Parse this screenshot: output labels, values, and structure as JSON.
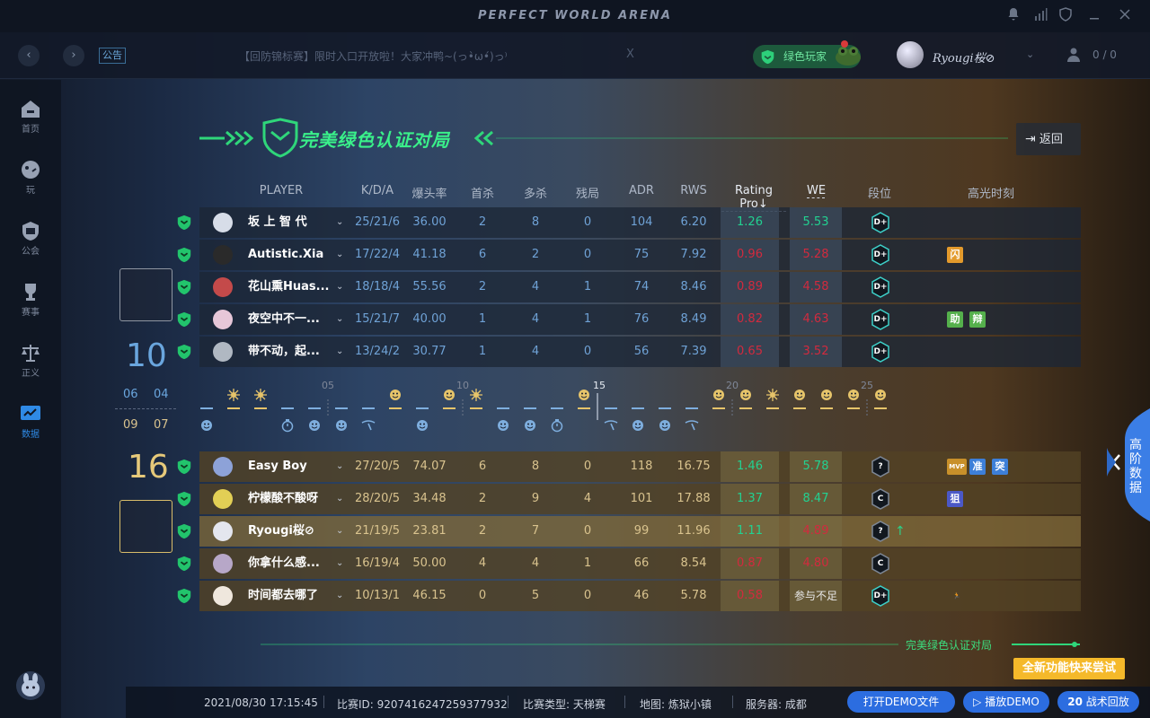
{
  "app": {
    "title": "PERFECT WORLD ARENA"
  },
  "topbar": {
    "notice_tag": "公告",
    "notice_text": "【回防锦标赛】限时入口开放啦！大家冲鸭~(っ•̀ω•́)っ⁾",
    "close": "X",
    "badge_label": "绿色玩家",
    "username": "Ryougi桜⊘",
    "friends_count": "0 / 0"
  },
  "sidebar": {
    "items": [
      {
        "label": "首页",
        "icon": "home-icon"
      },
      {
        "label": "玩",
        "icon": "gamepad-icon"
      },
      {
        "label": "公会",
        "icon": "guild-icon"
      },
      {
        "label": "赛事",
        "icon": "trophy-icon"
      },
      {
        "label": "正义",
        "icon": "scales-icon"
      },
      {
        "label": "数据",
        "icon": "chart-icon"
      }
    ]
  },
  "header": {
    "title": "完美绿色认证对局",
    "back_label": "返回"
  },
  "columns": [
    "PLAYER",
    "K/D/A",
    "爆头率",
    "首杀",
    "多杀",
    "残局",
    "ADR",
    "RWS",
    "Rating Pro",
    "WE",
    "段位",
    "高光时刻"
  ],
  "team_a": {
    "score": "10",
    "half1": "06",
    "half2": "04",
    "players": [
      {
        "name": "坂 上 智 代",
        "kda": "25/21/6",
        "hs": "36.00",
        "fk": "2",
        "mk": "8",
        "clutch": "0",
        "adr": "104",
        "rws": "6.20",
        "rating": "1.26",
        "we": "5.53",
        "rating_good": true,
        "we_good": true,
        "rank": "D+",
        "highlights": []
      },
      {
        "name": "Autistic.Xia",
        "kda": "17/22/4",
        "hs": "41.18",
        "fk": "6",
        "mk": "2",
        "clutch": "0",
        "adr": "75",
        "rws": "7.92",
        "rating": "0.96",
        "we": "5.28",
        "rating_good": false,
        "we_good": false,
        "rank": "D+",
        "highlights": [
          {
            "text": "闪",
            "color": "#e39a2c"
          }
        ]
      },
      {
        "name": "花山熏Huas...",
        "kda": "18/18/4",
        "hs": "55.56",
        "fk": "2",
        "mk": "4",
        "clutch": "1",
        "adr": "74",
        "rws": "8.46",
        "rating": "0.89",
        "we": "4.58",
        "rating_good": false,
        "we_good": false,
        "rank": "D+",
        "highlights": []
      },
      {
        "name": "夜空中不一...",
        "kda": "15/21/7",
        "hs": "40.00",
        "fk": "1",
        "mk": "4",
        "clutch": "1",
        "adr": "76",
        "rws": "8.49",
        "rating": "0.82",
        "we": "4.63",
        "rating_good": false,
        "we_good": false,
        "rank": "D+",
        "highlights": [
          {
            "text": "助",
            "color": "#55b04c"
          },
          {
            "text": "辩",
            "color": "#55b04c"
          }
        ]
      },
      {
        "name": "带不动，起...",
        "kda": "13/24/2",
        "hs": "30.77",
        "fk": "1",
        "mk": "4",
        "clutch": "0",
        "adr": "56",
        "rws": "7.39",
        "rating": "0.65",
        "we": "3.52",
        "rating_good": false,
        "we_good": false,
        "rank": "D+",
        "highlights": []
      }
    ]
  },
  "team_b": {
    "score": "16",
    "half1": "09",
    "half2": "07",
    "players": [
      {
        "name": "Easy Boy",
        "kda": "27/20/5",
        "hs": "74.07",
        "fk": "6",
        "mk": "8",
        "clutch": "0",
        "adr": "118",
        "rws": "16.75",
        "rating": "1.46",
        "we": "5.78",
        "rating_good": true,
        "we_good": true,
        "rank": "?",
        "highlights": [
          {
            "text": "MVP",
            "color": "#c8902a"
          },
          {
            "text": "准",
            "color": "#3d7fd8"
          },
          {
            "text": "突",
            "color": "#3d7fd8"
          }
        ]
      },
      {
        "name": "柠檬酸不酸呀",
        "kda": "28/20/5",
        "hs": "34.48",
        "fk": "2",
        "mk": "9",
        "clutch": "4",
        "adr": "101",
        "rws": "17.88",
        "rating": "1.37",
        "we": "8.47",
        "rating_good": true,
        "we_good": true,
        "rank": "C",
        "highlights": [
          {
            "text": "狙",
            "color": "#4b58c7"
          }
        ]
      },
      {
        "name": "Ryougi桜⊘",
        "kda": "21/19/5",
        "hs": "23.81",
        "fk": "2",
        "mk": "7",
        "clutch": "0",
        "adr": "99",
        "rws": "11.96",
        "rating": "1.11",
        "we": "4.89",
        "rating_good": true,
        "we_good": false,
        "rank": "?",
        "rank_up": true,
        "highlights": []
      },
      {
        "name": "你拿什么感...",
        "kda": "16/19/4",
        "hs": "50.00",
        "fk": "4",
        "mk": "4",
        "clutch": "1",
        "adr": "66",
        "rws": "8.54",
        "rating": "0.87",
        "we": "4.80",
        "rating_good": false,
        "we_good": false,
        "rank": "C",
        "highlights": []
      },
      {
        "name": "时间都去哪了",
        "kda": "10/13/1",
        "hs": "46.15",
        "fk": "0",
        "mk": "5",
        "clutch": "0",
        "adr": "46",
        "rws": "5.78",
        "rating": "0.58",
        "we": "参与不足",
        "rating_good": false,
        "we_insufficient": true,
        "rank": "D+",
        "highlights": [
          {
            "text": "🏃",
            "color": "transparent"
          }
        ]
      }
    ]
  },
  "timeline": {
    "labels": [
      "05",
      "10",
      "15",
      "20",
      "25"
    ],
    "rounds": [
      {
        "winner": "a",
        "icon": "smile"
      },
      {
        "winner": "b",
        "icon": "burst"
      },
      {
        "winner": "b",
        "icon": "burst"
      },
      {
        "winner": "a",
        "icon": "timer"
      },
      {
        "winner": "a",
        "icon": "smile"
      },
      {
        "winner": "a",
        "icon": "smile"
      },
      {
        "winner": "a",
        "icon": "defuse"
      },
      {
        "winner": "b",
        "icon": "smile"
      },
      {
        "winner": "a",
        "icon": "smile"
      },
      {
        "winner": "b",
        "icon": "smile"
      },
      {
        "winner": "b",
        "icon": "burst"
      },
      {
        "winner": "a",
        "icon": "smile"
      },
      {
        "winner": "a",
        "icon": "smile"
      },
      {
        "winner": "a",
        "icon": "timer"
      },
      {
        "winner": "b",
        "icon": "smile"
      },
      {
        "winner": "a",
        "icon": "defuse"
      },
      {
        "winner": "a",
        "icon": "smile"
      },
      {
        "winner": "a",
        "icon": "smile"
      },
      {
        "winner": "a",
        "icon": "defuse"
      },
      {
        "winner": "b",
        "icon": "smile"
      },
      {
        "winner": "b",
        "icon": "smile"
      },
      {
        "winner": "b",
        "icon": "burst"
      },
      {
        "winner": "b",
        "icon": "smile"
      },
      {
        "winner": "b",
        "icon": "smile"
      },
      {
        "winner": "b",
        "icon": "smile"
      },
      {
        "winner": "b",
        "icon": "smile"
      }
    ]
  },
  "footer": {
    "label": "完美绿色认证对局",
    "date": "2021/08/30 17:15:45",
    "match_id": "比赛ID: 9207416247259377932",
    "match_type": "比赛类型: 天梯赛",
    "map": "地图: 炼狱小镇",
    "server": "服务器: 成都",
    "btn_open_demo": "打开DEMO文件",
    "btn_play_demo": "播放DEMO",
    "btn_replay_count": "20",
    "btn_replay": "战术回放",
    "new_feature_tip": "全新功能快来尝试",
    "side_tab": "高阶数据"
  },
  "colors": {
    "green": "#33e07e",
    "blue_team": "#6fa2d6",
    "gold_team": "#d9c38e",
    "good": "#22d191",
    "bad": "#d22a3e"
  }
}
